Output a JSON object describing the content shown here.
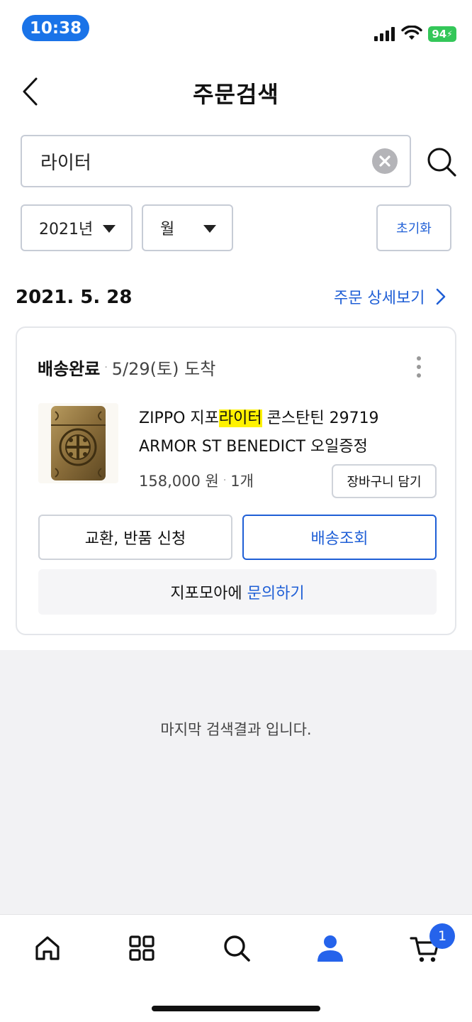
{
  "status_bar": {
    "time": "10:38",
    "battery": "94"
  },
  "header": {
    "title": "주문검색"
  },
  "search": {
    "value": "라이터"
  },
  "filters": {
    "year": "2021년",
    "month": "월",
    "reset_label": "초기화"
  },
  "order": {
    "date": "2021. 5. 28",
    "detail_link": "주문 상세보기",
    "status": "배송완료",
    "arrival": "5/29(토) 도착",
    "product": {
      "name_before": "ZIPPO 지포",
      "name_highlight": "라이터",
      "name_after": " 콘스탄틴 29719 ARMOR ST BENEDICT 오일증정",
      "price": "158,000 원",
      "quantity": "1개"
    },
    "cart_add_label": "장바구니 담기",
    "exchange_label": "교환, 반품 신청",
    "track_label": "배송조회",
    "inquiry_prefix": "지포모아에 ",
    "inquiry_link": "문의하기"
  },
  "end_message": "마지막 검색결과 입니다.",
  "bottom_nav": {
    "items": [
      "home-icon",
      "category-grid-icon",
      "search-icon",
      "my-page-icon",
      "cart-icon"
    ],
    "cart_count": "1",
    "active_color": "#2563eb"
  }
}
